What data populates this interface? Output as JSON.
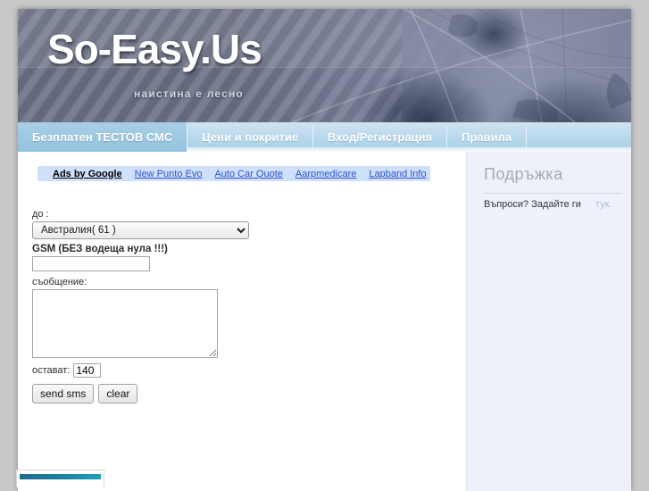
{
  "site": {
    "logo": "So-Easy.Us",
    "tagline": "наистина е лесно"
  },
  "nav": {
    "items": [
      {
        "label": "Безплатен ТЕСТОВ СМС",
        "active": true
      },
      {
        "label": "Цени и покритие",
        "active": false
      },
      {
        "label": "Вход/Регистрация",
        "active": false
      },
      {
        "label": "Правила",
        "active": false
      }
    ]
  },
  "ads": {
    "title": "Ads by Google",
    "links": [
      "New Punto Evo",
      "Auto Car Quote",
      "Aarpmedicare",
      "Lapband Info"
    ],
    "bg_color": "#cfe0fb",
    "link_color": "#2b55c4"
  },
  "form": {
    "to_label": "до :",
    "country_selected": "Австралия( 61 )",
    "country_options": [
      "Австралия( 61 )"
    ],
    "gsm_label": "GSM (БЕЗ водеща нула !!!)",
    "gsm_value": "",
    "gsm_placeholder": "",
    "message_label": "съобщение:",
    "message_value": "",
    "message_placeholder": "",
    "counter_label": "остават:",
    "counter_value": "140",
    "send_label": "send sms",
    "clear_label": "clear"
  },
  "sidebar": {
    "title": "Подръжка",
    "question_text": "Въпроси? Задайте ги",
    "here_link": "тук.",
    "bg_color": "#eef1fa",
    "title_color": "#a9a9a9",
    "link_color": "#9fc4da"
  },
  "theme": {
    "page_bg": "#c8c8c8",
    "container_bg": "#ffffff",
    "nav_bg": "#b9d9ec",
    "nav_active_bg": "#93c2de",
    "header_bg": "#5b5e62",
    "accent_teal": "#1b7e9e"
  }
}
